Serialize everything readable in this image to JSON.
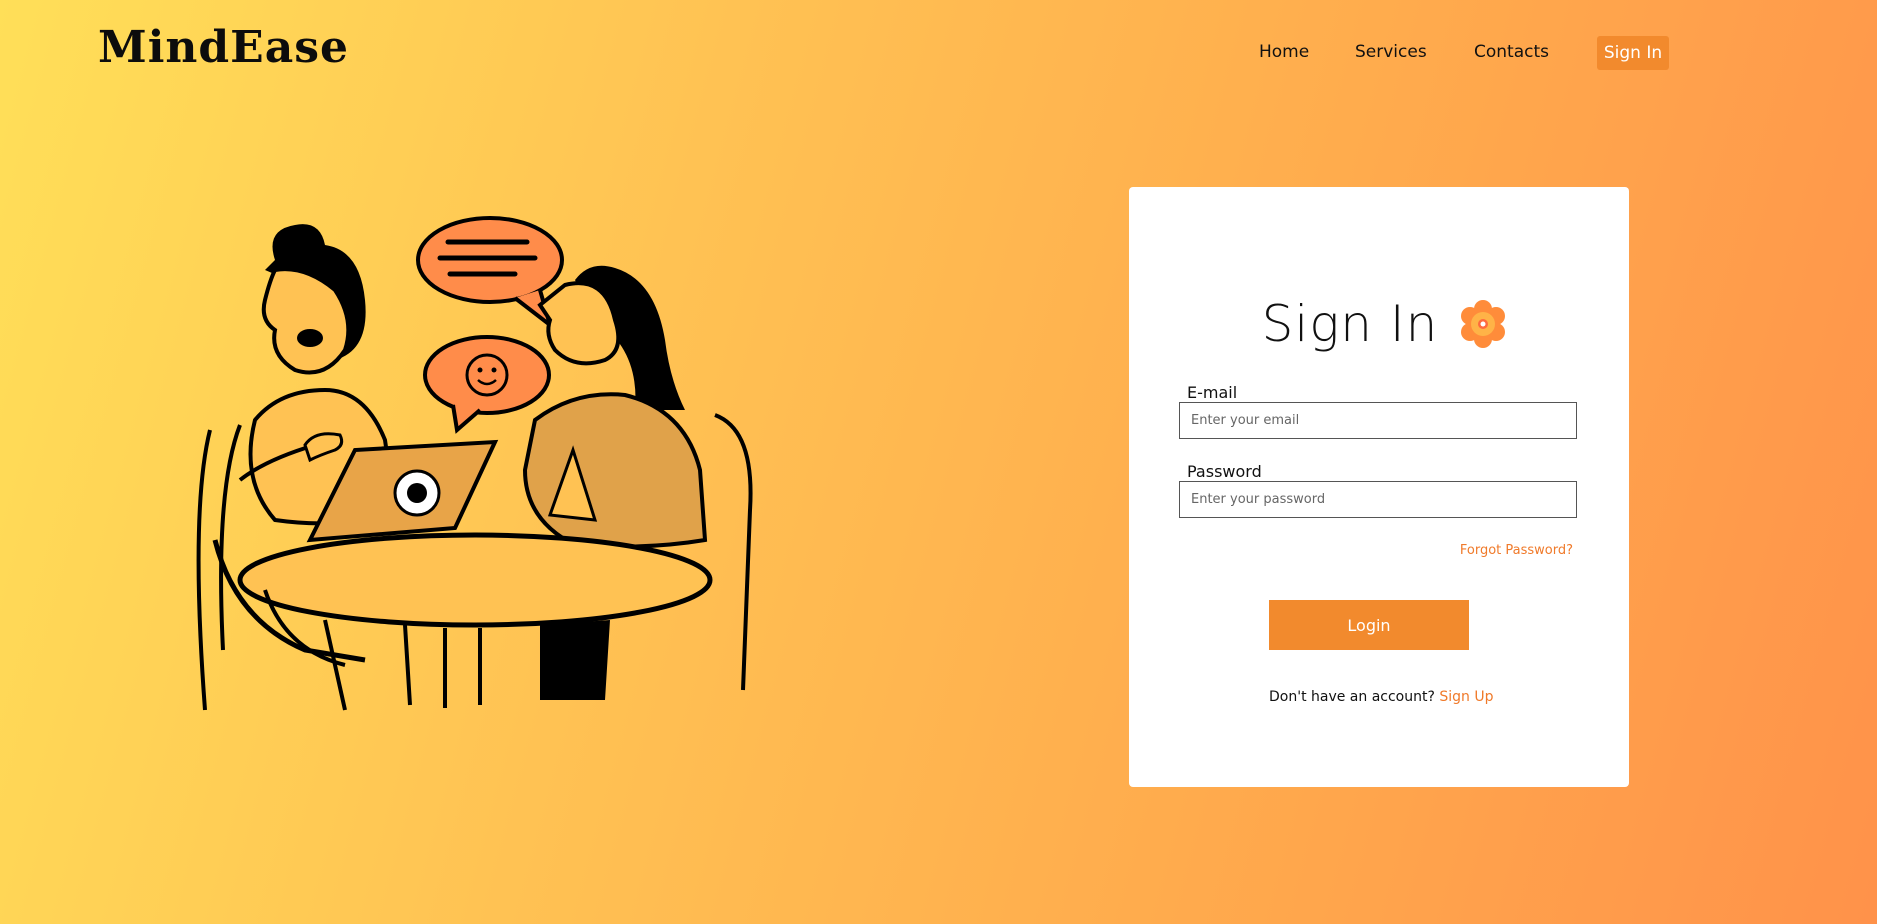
{
  "brand": {
    "logo_text": "MindEase"
  },
  "nav": {
    "items": [
      {
        "label": "Home"
      },
      {
        "label": "Services"
      },
      {
        "label": "Contacts"
      }
    ],
    "signin_label": "Sign In"
  },
  "signin_card": {
    "title": "Sign In",
    "title_icon": "flower-icon",
    "email": {
      "label": "E-mail",
      "placeholder": "Enter your email",
      "value": ""
    },
    "password": {
      "label": "Password",
      "placeholder": "Enter your password",
      "value": ""
    },
    "forgot_password_label": "Forgot Password?",
    "login_label": "Login",
    "signup_prompt": "Don't have an account?",
    "signup_link": "Sign Up"
  },
  "colors": {
    "accent": "#f28a2d",
    "link": "#f07a2a",
    "bubble": "#ff8c4a",
    "background_start": "#ffdf58",
    "background_end": "#ff924a"
  },
  "illustration": {
    "icons": [
      "chat-bubble-icon",
      "smiley-bubble-icon",
      "tablet-flower-icon"
    ]
  }
}
